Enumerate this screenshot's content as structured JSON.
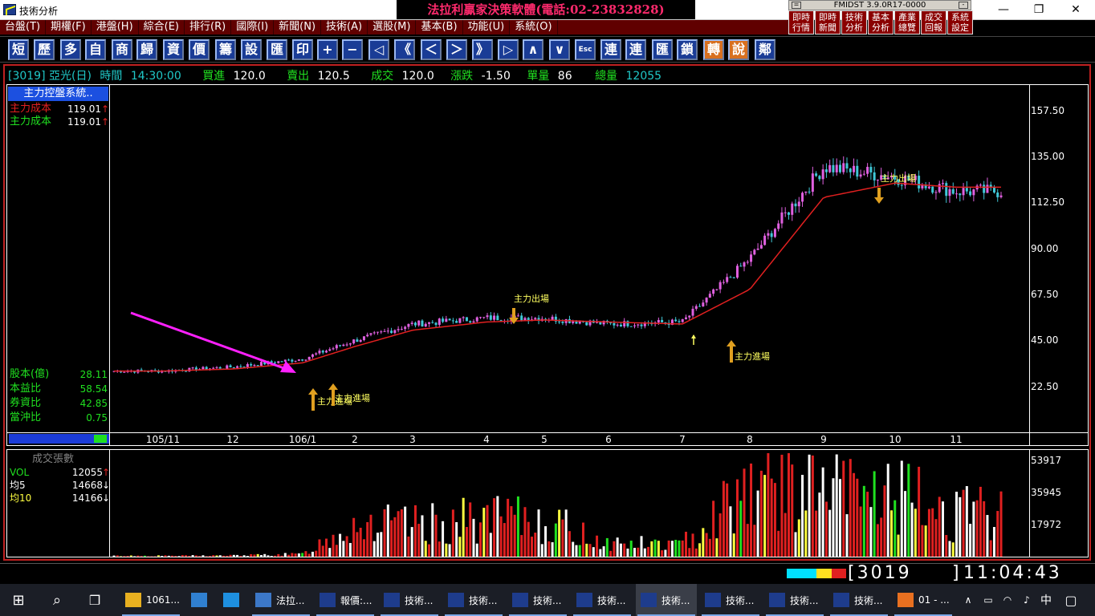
{
  "window": {
    "title": "技術分析",
    "banner": "法拉利贏家決策軟體(電話:02-23832828)",
    "fmidst": "FMIDST 3.9.0R17-0000",
    "min": "—",
    "max": "❐",
    "close": "✕",
    "mini_left": "=",
    "mini_right": "-",
    "quick_buttons": [
      "即時\n行情",
      "即時\n新聞",
      "技術\n分析",
      "基本\n分析",
      "產業\n總覽",
      "成交\n回報",
      "系統\n設定"
    ]
  },
  "menu": [
    "台盤(T)",
    "期權(F)",
    "港盤(H)",
    "綜合(E)",
    "排行(R)",
    "國際(I)",
    "新聞(N)",
    "技術(A)",
    "選股(M)",
    "基本(B)",
    "功能(U)",
    "系統(O)"
  ],
  "toolbar": [
    "短",
    "歷",
    "多",
    "自",
    "商",
    "歸",
    "資",
    "價",
    "籌",
    "設",
    "匯",
    "印",
    "+",
    "−",
    "◁",
    "《",
    "＜",
    "＞",
    "》",
    "▷",
    "∧",
    "∨",
    "Esc",
    "連",
    "連",
    "匯",
    "鎖",
    "轉",
    "說",
    "鄰"
  ],
  "quote": {
    "code": "[3019] 亞光(日)",
    "time_label": "時間",
    "time": "14:30:00",
    "bid_label": "買進",
    "bid": "120.0",
    "ask_label": "賣出",
    "ask": "120.5",
    "trade_label": "成交",
    "trade": "120.0",
    "change_label": "漲跌",
    "change": "-1.50",
    "unit_label": "單量",
    "unit": "86",
    "total_label": "總量",
    "total": "12055"
  },
  "main_panel": {
    "system_title": "主力控盤系統..",
    "cost_rows": [
      {
        "label": "主力成本",
        "value": "119.01",
        "arrow": "↑",
        "color": "#e02020"
      },
      {
        "label": "主力成本",
        "value": "119.01",
        "arrow": "↑",
        "color": "#20e020"
      }
    ],
    "fund_rows": [
      {
        "label": "股本(億)",
        "value": "28.11"
      },
      {
        "label": "本益比",
        "value": "58.54"
      },
      {
        "label": "券資比",
        "value": "42.85"
      },
      {
        "label": "當沖比",
        "value": "0.75"
      }
    ],
    "y_ticks": [
      "157.50",
      "135.00",
      "112.50",
      "90.00",
      "67.50",
      "45.00",
      "22.50"
    ],
    "x_ticks": [
      "105/11",
      "12",
      "106/1",
      "2",
      "3",
      "4",
      "5",
      "6",
      "7",
      "8",
      "9",
      "10",
      "11"
    ],
    "annotations": [
      {
        "text": "主力出場",
        "kind": "exit"
      },
      {
        "text": "主力出場",
        "kind": "exit"
      },
      {
        "text": "主力進場",
        "kind": "enter"
      },
      {
        "text": "主力進場",
        "kind": "enter"
      },
      {
        "text": "主力進場",
        "kind": "enter"
      }
    ]
  },
  "volume_panel": {
    "title": "成交張數",
    "rows": [
      {
        "label": "VOL",
        "value": "12055",
        "arrow": "↑",
        "color": "#20e020"
      },
      {
        "label": "均5",
        "value": "14668",
        "arrow": "↓",
        "color": "#fff"
      },
      {
        "label": "均10",
        "value": "14166",
        "arrow": "↓",
        "color": "#ffff40"
      }
    ],
    "y_ticks": [
      "53917",
      "35945",
      "17972"
    ]
  },
  "status": {
    "code": "[3019",
    "bracket": "]",
    "clock": "11:04:43"
  },
  "taskbar": {
    "items": [
      "1061...",
      "",
      "",
      "法拉...",
      "報價:...",
      "技術...",
      "技術...",
      "技術...",
      "技術...",
      "技術...",
      "技術...",
      "技術...",
      "技術...",
      "01 - ..."
    ],
    "ime": "中",
    "tray_up": "∧"
  },
  "colors": {
    "up": "#e060e0",
    "down": "#40c8d8",
    "ma": "#e02020",
    "accent": "#ff2a6d"
  },
  "chart_data": {
    "type": "candlestick",
    "title": "",
    "x_categories": [
      "105/11",
      "12",
      "106/1",
      "2",
      "3",
      "4",
      "5",
      "6",
      "7",
      "8",
      "9",
      "10",
      "11"
    ],
    "close_by_month": [
      30,
      32,
      36,
      45,
      53,
      56,
      56,
      53,
      54,
      85,
      130,
      125,
      118
    ],
    "ma_by_month": [
      30,
      31,
      34,
      42,
      50,
      54,
      55,
      54,
      53,
      70,
      115,
      122,
      120
    ],
    "ylim": [
      0,
      170
    ],
    "volume_by_month": [
      500,
      700,
      1500,
      20000,
      18000,
      22000,
      21000,
      8000,
      7000,
      45000,
      38000,
      36000,
      25000
    ],
    "volume_ylim": [
      0,
      60000
    ]
  }
}
